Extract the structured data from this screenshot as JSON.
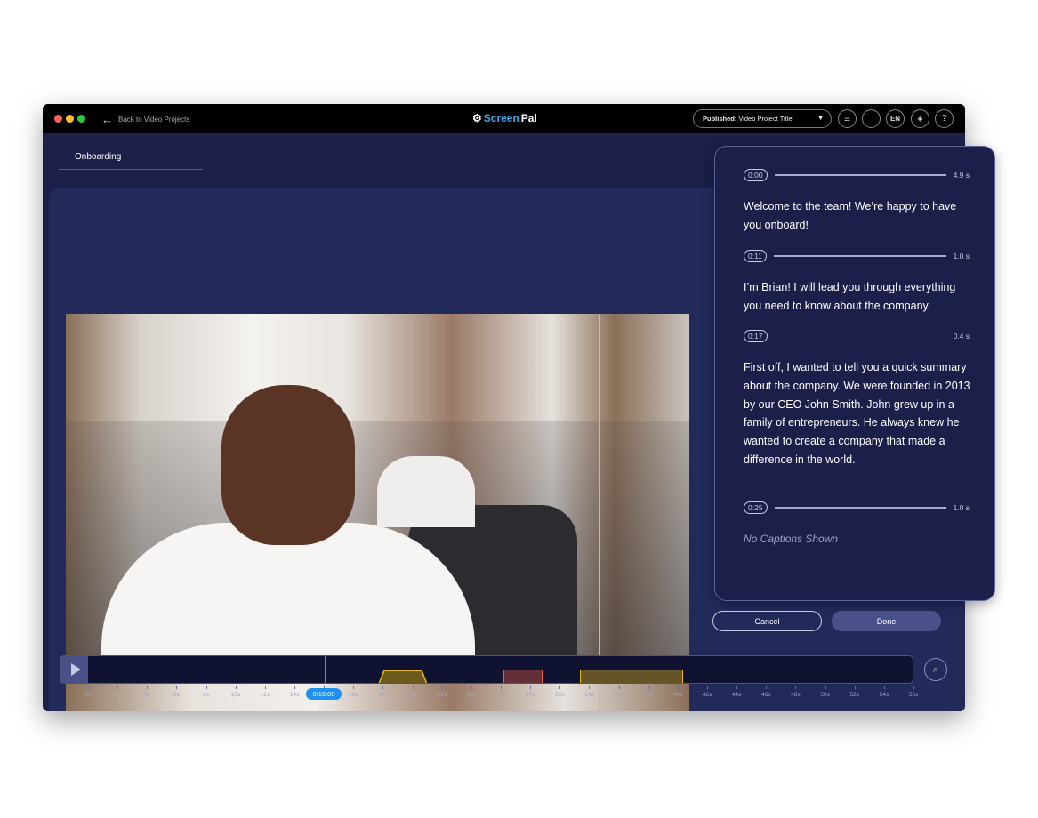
{
  "titlebar": {
    "back_label": "Back to Video Projects",
    "logo_screen": "Screen",
    "logo_pal": "Pal",
    "publish_prefix": "Published:",
    "publish_title": "Video Project Title",
    "lang": "EN",
    "help": "?"
  },
  "tab": {
    "label": "Onboarding"
  },
  "captions": [
    {
      "time": "0:00",
      "duration": "4.9 s",
      "has_line": true,
      "text": "Welcome to the team! We’re happy to have you onboard!"
    },
    {
      "time": "0:11",
      "duration": "1.0 s",
      "has_line": true,
      "text": "I’m Brian! I will lead you through everything you need to know about the company."
    },
    {
      "time": "0:17",
      "duration": "0.4 s",
      "has_line": false,
      "text": "First off, I wanted to tell you a quick summary about the company. We were founded in 2013 by our CEO John Smith. John grew up in a family of entrepreneurs. He always knew he wanted to create a company that made a difference in the world."
    },
    {
      "time": "0:25",
      "duration": "1.0 s",
      "has_line": true,
      "text": ""
    }
  ],
  "no_captions": "No Captions Shown",
  "buttons": {
    "cancel": "Cancel",
    "done": "Done"
  },
  "timeline": {
    "playhead_seconds": 16,
    "playhead_label": "0:16:00",
    "ticks": [
      "0s",
      "2s",
      "4s",
      "6s",
      "8s",
      "10s",
      "12s",
      "14s",
      "16s",
      "18s",
      "20s",
      "22s",
      "24s",
      "26s",
      "28s",
      "30s",
      "32s",
      "34s",
      "36s",
      "38s",
      "40s",
      "42s",
      "44s",
      "46s",
      "48s",
      "50s",
      "52s",
      "54s",
      "56s"
    ],
    "segments": [
      {
        "start": 19.6,
        "end": 23,
        "color": "#e8b820",
        "shape": "trapezoid"
      },
      {
        "start": 28.1,
        "end": 30.8,
        "color": "#e0604a",
        "shape": "rect"
      },
      {
        "start": 33.3,
        "end": 40.3,
        "color": "#e8b820",
        "shape": "rect"
      }
    ]
  },
  "colors": {
    "accent": "#1e90f0",
    "background": "#1c2048"
  }
}
